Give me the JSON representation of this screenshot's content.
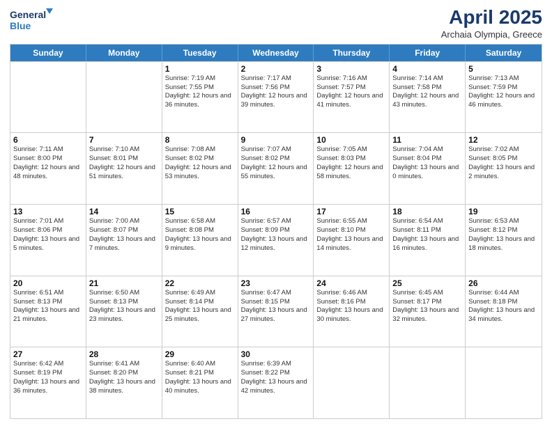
{
  "header": {
    "logo_line1": "General",
    "logo_line2": "Blue",
    "main_title": "April 2025",
    "subtitle": "Archaia Olympia, Greece"
  },
  "weekdays": [
    "Sunday",
    "Monday",
    "Tuesday",
    "Wednesday",
    "Thursday",
    "Friday",
    "Saturday"
  ],
  "rows": [
    [
      {
        "date": "",
        "info": ""
      },
      {
        "date": "",
        "info": ""
      },
      {
        "date": "1",
        "info": "Sunrise: 7:19 AM\nSunset: 7:55 PM\nDaylight: 12 hours and 36 minutes."
      },
      {
        "date": "2",
        "info": "Sunrise: 7:17 AM\nSunset: 7:56 PM\nDaylight: 12 hours and 39 minutes."
      },
      {
        "date": "3",
        "info": "Sunrise: 7:16 AM\nSunset: 7:57 PM\nDaylight: 12 hours and 41 minutes."
      },
      {
        "date": "4",
        "info": "Sunrise: 7:14 AM\nSunset: 7:58 PM\nDaylight: 12 hours and 43 minutes."
      },
      {
        "date": "5",
        "info": "Sunrise: 7:13 AM\nSunset: 7:59 PM\nDaylight: 12 hours and 46 minutes."
      }
    ],
    [
      {
        "date": "6",
        "info": "Sunrise: 7:11 AM\nSunset: 8:00 PM\nDaylight: 12 hours and 48 minutes."
      },
      {
        "date": "7",
        "info": "Sunrise: 7:10 AM\nSunset: 8:01 PM\nDaylight: 12 hours and 51 minutes."
      },
      {
        "date": "8",
        "info": "Sunrise: 7:08 AM\nSunset: 8:02 PM\nDaylight: 12 hours and 53 minutes."
      },
      {
        "date": "9",
        "info": "Sunrise: 7:07 AM\nSunset: 8:02 PM\nDaylight: 12 hours and 55 minutes."
      },
      {
        "date": "10",
        "info": "Sunrise: 7:05 AM\nSunset: 8:03 PM\nDaylight: 12 hours and 58 minutes."
      },
      {
        "date": "11",
        "info": "Sunrise: 7:04 AM\nSunset: 8:04 PM\nDaylight: 13 hours and 0 minutes."
      },
      {
        "date": "12",
        "info": "Sunrise: 7:02 AM\nSunset: 8:05 PM\nDaylight: 13 hours and 2 minutes."
      }
    ],
    [
      {
        "date": "13",
        "info": "Sunrise: 7:01 AM\nSunset: 8:06 PM\nDaylight: 13 hours and 5 minutes."
      },
      {
        "date": "14",
        "info": "Sunrise: 7:00 AM\nSunset: 8:07 PM\nDaylight: 13 hours and 7 minutes."
      },
      {
        "date": "15",
        "info": "Sunrise: 6:58 AM\nSunset: 8:08 PM\nDaylight: 13 hours and 9 minutes."
      },
      {
        "date": "16",
        "info": "Sunrise: 6:57 AM\nSunset: 8:09 PM\nDaylight: 13 hours and 12 minutes."
      },
      {
        "date": "17",
        "info": "Sunrise: 6:55 AM\nSunset: 8:10 PM\nDaylight: 13 hours and 14 minutes."
      },
      {
        "date": "18",
        "info": "Sunrise: 6:54 AM\nSunset: 8:11 PM\nDaylight: 13 hours and 16 minutes."
      },
      {
        "date": "19",
        "info": "Sunrise: 6:53 AM\nSunset: 8:12 PM\nDaylight: 13 hours and 18 minutes."
      }
    ],
    [
      {
        "date": "20",
        "info": "Sunrise: 6:51 AM\nSunset: 8:13 PM\nDaylight: 13 hours and 21 minutes."
      },
      {
        "date": "21",
        "info": "Sunrise: 6:50 AM\nSunset: 8:13 PM\nDaylight: 13 hours and 23 minutes."
      },
      {
        "date": "22",
        "info": "Sunrise: 6:49 AM\nSunset: 8:14 PM\nDaylight: 13 hours and 25 minutes."
      },
      {
        "date": "23",
        "info": "Sunrise: 6:47 AM\nSunset: 8:15 PM\nDaylight: 13 hours and 27 minutes."
      },
      {
        "date": "24",
        "info": "Sunrise: 6:46 AM\nSunset: 8:16 PM\nDaylight: 13 hours and 30 minutes."
      },
      {
        "date": "25",
        "info": "Sunrise: 6:45 AM\nSunset: 8:17 PM\nDaylight: 13 hours and 32 minutes."
      },
      {
        "date": "26",
        "info": "Sunrise: 6:44 AM\nSunset: 8:18 PM\nDaylight: 13 hours and 34 minutes."
      }
    ],
    [
      {
        "date": "27",
        "info": "Sunrise: 6:42 AM\nSunset: 8:19 PM\nDaylight: 13 hours and 36 minutes."
      },
      {
        "date": "28",
        "info": "Sunrise: 6:41 AM\nSunset: 8:20 PM\nDaylight: 13 hours and 38 minutes."
      },
      {
        "date": "29",
        "info": "Sunrise: 6:40 AM\nSunset: 8:21 PM\nDaylight: 13 hours and 40 minutes."
      },
      {
        "date": "30",
        "info": "Sunrise: 6:39 AM\nSunset: 8:22 PM\nDaylight: 13 hours and 42 minutes."
      },
      {
        "date": "",
        "info": ""
      },
      {
        "date": "",
        "info": ""
      },
      {
        "date": "",
        "info": ""
      }
    ]
  ]
}
